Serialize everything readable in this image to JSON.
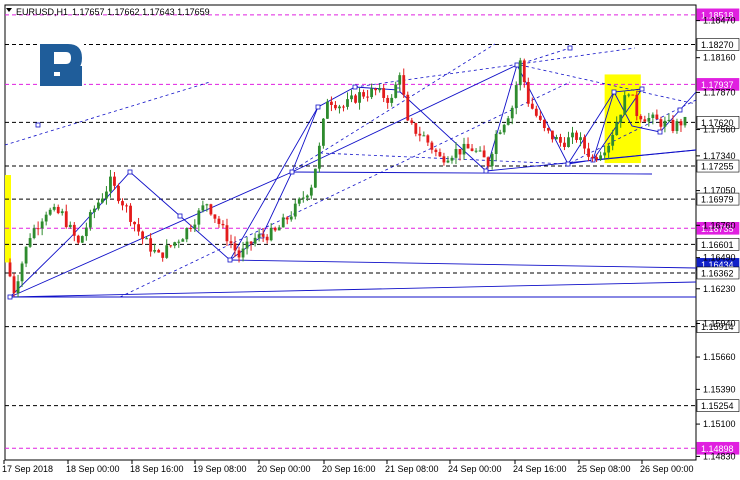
{
  "header": {
    "symbol": "EURUSD,H1",
    "ohlc": "1.17657 1.17662 1.17643 1.17659"
  },
  "logo": {
    "text": "R"
  },
  "colors": {
    "bull": "#2e8b2e",
    "bear": "#e31b1b",
    "trend": "#1010c8",
    "level_black": "#000000",
    "level_magenta": "#e020e0",
    "highlight": "#ffff00",
    "price_box_blue": "#1020c8"
  },
  "chart_data": {
    "type": "candlestick",
    "title": "",
    "y_range": [
      1.148,
      1.186
    ],
    "x_labels": [
      "17 Sep 2018",
      "18 Sep 00:00",
      "18 Sep 16:00",
      "19 Sep 08:00",
      "20 Sep 00:00",
      "20 Sep 16:00",
      "21 Sep 08:00",
      "24 Sep 00:00",
      "24 Sep 16:00",
      "25 Sep 08:00",
      "26 Sep 00:00"
    ],
    "y_ticks": [
      "1.18470",
      "1.18160",
      "1.17870",
      "1.17560",
      "1.17340",
      "1.17050",
      "1.16760",
      "1.16490",
      "1.16230",
      "1.15940",
      "1.15660",
      "1.15390",
      "1.15100",
      "1.14830"
    ],
    "levels": [
      {
        "label": "1.18518",
        "value": 1.18518,
        "style": "magenta"
      },
      {
        "label": "1.18270",
        "value": 1.1827,
        "style": "black"
      },
      {
        "label": "1.17937",
        "value": 1.17937,
        "style": "magenta"
      },
      {
        "label": "1.17620",
        "value": 1.1762,
        "style": "black"
      },
      {
        "label": "1.17255",
        "value": 1.17255,
        "style": "black"
      },
      {
        "label": "1.16979",
        "value": 1.16979,
        "style": "black"
      },
      {
        "label": "1.16735",
        "value": 1.16735,
        "style": "magenta"
      },
      {
        "label": "1.16601",
        "value": 1.16601,
        "style": "black"
      },
      {
        "label": "1.16434",
        "value": 1.16434,
        "style": "blue"
      },
      {
        "label": "1.16362",
        "value": 1.16362,
        "style": "black"
      },
      {
        "label": "1.15914",
        "value": 1.15914,
        "style": "black"
      },
      {
        "label": "1.15254",
        "value": 1.15254,
        "style": "black"
      },
      {
        "label": "1.14898",
        "value": 1.14898,
        "style": "magenta"
      }
    ],
    "waypoints": [
      [
        0,
        1.1645
      ],
      [
        2,
        1.1622
      ],
      [
        6,
        1.1668
      ],
      [
        10,
        1.1688
      ],
      [
        14,
        1.1685
      ],
      [
        18,
        1.166
      ],
      [
        22,
        1.169
      ],
      [
        26,
        1.1712
      ],
      [
        30,
        1.169
      ],
      [
        34,
        1.1665
      ],
      [
        38,
        1.165
      ],
      [
        44,
        1.1668
      ],
      [
        50,
        1.1695
      ],
      [
        54,
        1.1672
      ],
      [
        58,
        1.165
      ],
      [
        62,
        1.1665
      ],
      [
        67,
        1.167
      ],
      [
        72,
        1.169
      ],
      [
        76,
        1.171
      ],
      [
        78,
        1.174
      ],
      [
        80,
        1.1782
      ],
      [
        84,
        1.1775
      ],
      [
        88,
        1.1785
      ],
      [
        92,
        1.1788
      ],
      [
        96,
        1.178
      ],
      [
        98,
        1.1805
      ],
      [
        100,
        1.176
      ],
      [
        104,
        1.175
      ],
      [
        108,
        1.1732
      ],
      [
        112,
        1.1738
      ],
      [
        116,
        1.174
      ],
      [
        120,
        1.1728
      ],
      [
        122,
        1.1752
      ],
      [
        126,
        1.1775
      ],
      [
        128,
        1.1812
      ],
      [
        130,
        1.178
      ],
      [
        134,
        1.1755
      ],
      [
        138,
        1.1745
      ],
      [
        142,
        1.175
      ],
      [
        146,
        1.1732
      ],
      [
        150,
        1.1745
      ],
      [
        153,
        1.1772
      ],
      [
        155,
        1.179
      ],
      [
        157,
        1.177
      ],
      [
        160,
        1.1765
      ],
      [
        163,
        1.1762
      ],
      [
        166,
        1.1758
      ],
      [
        168,
        1.1762
      ]
    ],
    "candle_count": 169
  }
}
